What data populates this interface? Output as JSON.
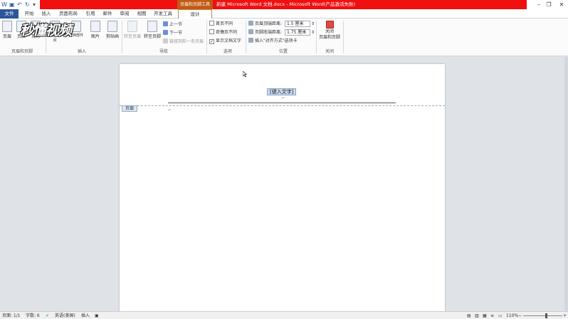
{
  "titlebar": {
    "context_tab": "页眉和页脚工具",
    "document_title": "新建 Microsoft Word 文档.docx - Microsoft Word(产品激活失败)",
    "restore_glyph": "❐",
    "close_glyph": "✕",
    "min_glyph": "–",
    "quick_icons": [
      "word-logo-icon",
      "save-icon",
      "undo-icon",
      "redo-icon"
    ]
  },
  "tabs": [
    "文件",
    "开始",
    "插入",
    "页面布局",
    "引用",
    "邮件",
    "审阅",
    "视图",
    "开发工具",
    "设计"
  ],
  "watermark": "秒懂视频",
  "ribbon": {
    "group_header_footer": {
      "label": "页眉和页脚",
      "buttons": [
        "页眉",
        "页脚",
        "页码"
      ]
    },
    "group_insert": {
      "label": "插入",
      "buttons": [
        "日期和时间",
        "文档部件",
        "图片",
        "剪贴画"
      ]
    },
    "group_nav": {
      "label": "导航",
      "goto_header": "转至页眉",
      "goto_footer": "转至页脚",
      "prev": "上一节",
      "next": "下一节",
      "link_prev": "链接到前一条页眉"
    },
    "group_options": {
      "label": "选项",
      "diff_first": "首页不同",
      "diff_odd_even": "奇偶页不同",
      "show_text": "显示文档文字",
      "show_text_checked": true
    },
    "group_position": {
      "label": "位置",
      "header_top_label": "页眉顶端距离:",
      "header_top_value": "1.5 厘米",
      "footer_bottom_label": "页脚底端距离:",
      "footer_bottom_value": "1.75 厘米",
      "insert_align_tab": "插入\"对齐方式\"选项卡"
    },
    "group_close": {
      "label": "关闭",
      "close_btn": "关闭\n页眉和页脚"
    }
  },
  "document": {
    "header_field": "[键入文字]",
    "header_tag": "页眉"
  },
  "status": {
    "page": "页面: 1/1",
    "words": "字数: 6",
    "lang": "英语(美国)",
    "mode": "插入",
    "zoom": "110%"
  }
}
